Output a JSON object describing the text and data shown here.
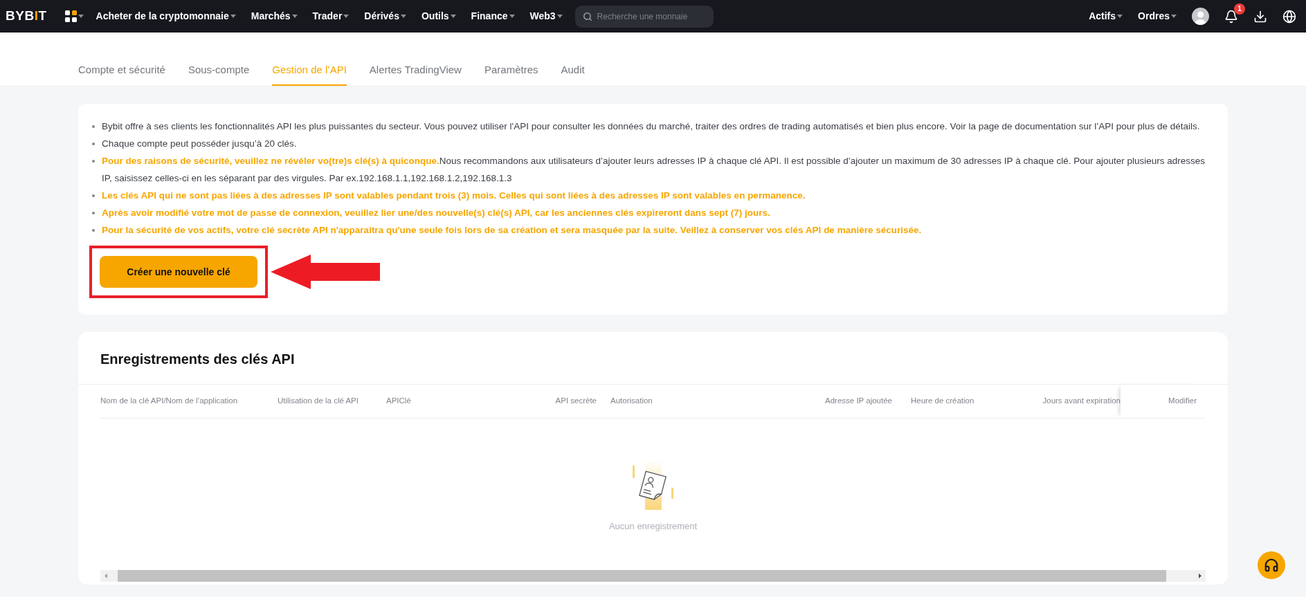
{
  "nav": {
    "logo": "BYBIT",
    "menu": [
      {
        "label": "Acheter de la cryptomonnaie"
      },
      {
        "label": "Marchés"
      },
      {
        "label": "Trader"
      },
      {
        "label": "Dérivés"
      },
      {
        "label": "Outils"
      },
      {
        "label": "Finance"
      },
      {
        "label": "Web3"
      }
    ],
    "search": {
      "placeholder": "Recherche une monnaie"
    },
    "right_menu": [
      {
        "label": "Actifs"
      },
      {
        "label": "Ordres"
      }
    ],
    "notifications_badge": "1"
  },
  "tabs": [
    {
      "label": "Compte et sécurité",
      "selected": false
    },
    {
      "label": "Sous-compte",
      "selected": false
    },
    {
      "label": "Gestion de l’API",
      "selected": true
    },
    {
      "label": "Alertes TradingView",
      "selected": false
    },
    {
      "label": "Paramètres",
      "selected": false
    },
    {
      "label": "Audit",
      "selected": false
    }
  ],
  "notice": {
    "bullets": [
      {
        "kind": "info",
        "text": "Bybit offre à ses clients les fonctionnalités API les plus puissantes du secteur. Vous pouvez utiliser l'API pour consulter les données du marché, traiter des ordres de trading automatisés et bien plus encore. Voir la page de documentation sur l’API pour plus de détails."
      },
      {
        "kind": "info",
        "text": "Chaque compte peut posséder jusqu’à 20 clés."
      },
      {
        "kind": "mixed",
        "lead": "Pour des raisons de sécurité, veuillez ne révéler vo(tre)s clé(s) à quiconque.",
        "text": "Nous recommandons aux utilisateurs d’ajouter leurs adresses IP à chaque clé API. Il est possible d’ajouter un maximum de 30 adresses IP à chaque clé. Pour ajouter plusieurs adresses IP, saisissez celles-ci en les séparant par des virgules. Par ex.192.168.1.1,192.168.1.2,192.168.1.3"
      },
      {
        "kind": "warning",
        "text": "Les clés API qui ne sont pas liées à des adresses IP sont valables pendant trois (3) mois. Celles qui sont liées à des adresses IP sont valables en permanence."
      },
      {
        "kind": "warning",
        "text": "Après avoir modifié votre mot de passe de connexion, veuillez lier une/des nouvelle(s) clé(s) API, car les anciennes clés expireront dans sept (7) jours."
      },
      {
        "kind": "warning",
        "text": "Pour la sécurité de vos actifs, votre clé secrète API n'apparaîtra qu'une seule fois lors de sa création et sera masquée par la suite. Veillez à conserver vos clés API de manière sécurisée."
      }
    ],
    "create_button": "Créer une nouvelle clé"
  },
  "records": {
    "title": "Enregistrements des clés API",
    "columns": [
      {
        "label": "Nom de la clé API/Nom de l’application"
      },
      {
        "label": "Utilisation de la clé API"
      },
      {
        "label": "APIClé"
      },
      {
        "label": "API secrète"
      },
      {
        "label": "Autorisation"
      },
      {
        "label": "Adresse IP ajoutée"
      },
      {
        "label": "Heure de création"
      },
      {
        "label": "Jours avant expiration"
      },
      {
        "label": "Modifier"
      }
    ],
    "empty_text": "Aucun enregistrement"
  }
}
